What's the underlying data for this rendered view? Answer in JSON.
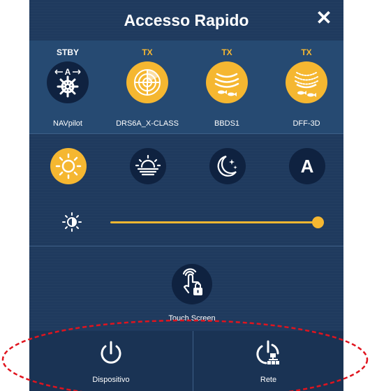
{
  "header": {
    "title": "Accesso Rapido",
    "close_glyph": "✕"
  },
  "sources": [
    {
      "status": "STBY",
      "status_color": "#ffffff",
      "label": "NAVpilot",
      "icon": "autopilot-helm-icon",
      "fill": "#0f2240"
    },
    {
      "status": "TX",
      "status_color": "#f5b731",
      "label": "DRS6A_X-CLASS",
      "icon": "radar-icon",
      "fill": "#f5b731"
    },
    {
      "status": "TX",
      "status_color": "#f5b731",
      "label": "BBDS1",
      "icon": "fish-finder-icon",
      "fill": "#f5b731"
    },
    {
      "status": "TX",
      "status_color": "#f5b731",
      "label": "DFF-3D",
      "icon": "multibeam-sonar-icon",
      "fill": "#f5b731"
    }
  ],
  "display_modes": {
    "items": [
      "day-sun-icon",
      "sunset-icon",
      "night-moon-icon",
      "auto-a-icon"
    ],
    "auto_letter": "A",
    "selected": "day"
  },
  "brightness": {
    "level": 1.0,
    "icon": "brightness-icon"
  },
  "touch_screen": {
    "label": "Touch Screen",
    "icon": "touch-lock-icon"
  },
  "bottom": {
    "device_label": "Dispositivo",
    "network_label": "Rete"
  },
  "colors": {
    "accent": "#f5b731",
    "panel": "#1f3a5e",
    "highlight_oval": "#e0141e"
  }
}
